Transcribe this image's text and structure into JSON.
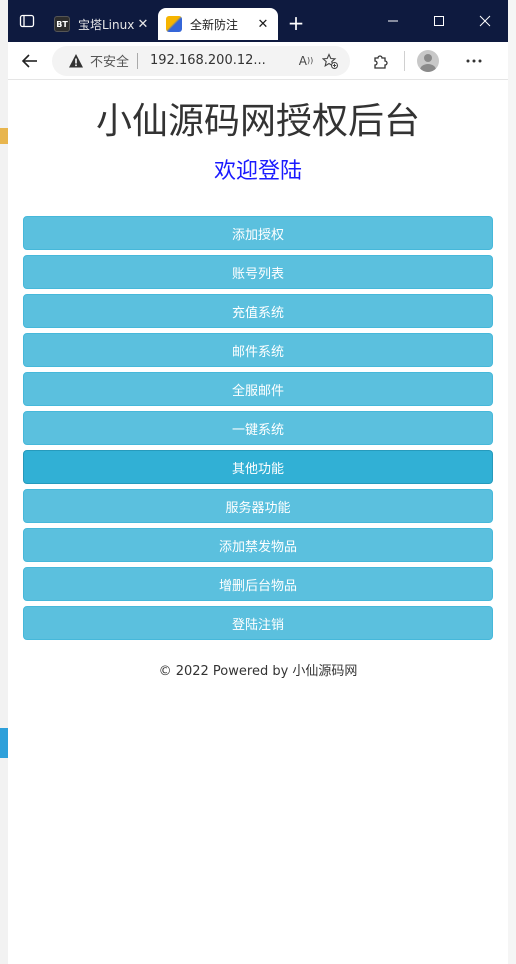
{
  "browser": {
    "tabs": [
      {
        "title": "宝塔Linux",
        "favicon": "BT",
        "active": false
      },
      {
        "title": "全新防注",
        "active": true
      }
    ],
    "address": {
      "security_label": "不安全",
      "url": "192.168.200.12..."
    }
  },
  "page": {
    "title": "小仙源码网授权后台",
    "subtitle": "欢迎登陆",
    "buttons": [
      {
        "label": "添加授权"
      },
      {
        "label": "账号列表"
      },
      {
        "label": "充值系统"
      },
      {
        "label": "邮件系统"
      },
      {
        "label": "全服邮件"
      },
      {
        "label": "一键系统"
      },
      {
        "label": "其他功能"
      },
      {
        "label": "服务器功能"
      },
      {
        "label": "添加禁发物品"
      },
      {
        "label": "增删后台物品"
      },
      {
        "label": "登陆注销"
      }
    ],
    "footer": "© 2022 Powered by 小仙源码网"
  },
  "colors": {
    "titlebar": "#0e1a3f",
    "button": "#5bc0de",
    "button_active": "#31b0d5",
    "subtitle": "#1a1aff"
  }
}
